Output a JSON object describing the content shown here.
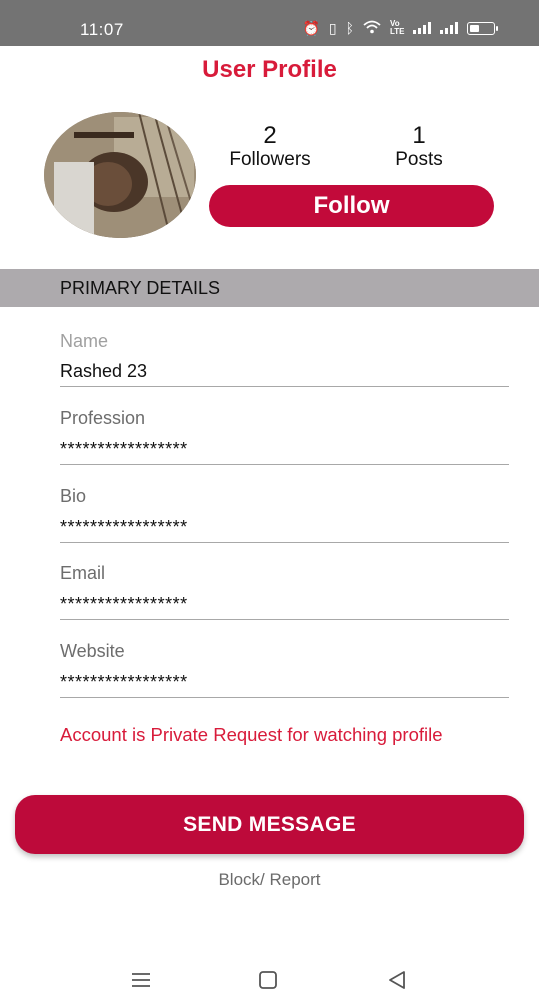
{
  "status_bar": {
    "time": "11:07",
    "icons": [
      "alarm-icon",
      "vibrate-icon",
      "bluetooth-icon",
      "wifi-icon",
      "volte-icon",
      "signal-icon",
      "signal-icon",
      "battery-icon"
    ],
    "volte_text": "Vo LTE"
  },
  "header": {
    "title": "User Profile"
  },
  "profile": {
    "followers_count": "2",
    "followers_label": "Followers",
    "posts_count": "1",
    "posts_label": "Posts",
    "follow_label": "Follow"
  },
  "section": {
    "title": "PRIMARY DETAILS"
  },
  "fields": [
    {
      "label": "Name",
      "value": "Rashed 23"
    },
    {
      "label": "Profession",
      "value": "*****************"
    },
    {
      "label": "Bio",
      "value": "*****************"
    },
    {
      "label": "Email",
      "value": "*****************"
    },
    {
      "label": "Website",
      "value": "*****************"
    }
  ],
  "private_notice": "Account is Private Request for watching profile",
  "send_message_label": "SEND MESSAGE",
  "block_report_label": "Block/ Report",
  "nav": {
    "icons": [
      "menu-icon",
      "home-icon",
      "back-icon"
    ]
  },
  "colors": {
    "accent": "#c20a3a",
    "title_red": "#d81b3a",
    "status_bar": "#737373",
    "section_header": "#adaaad"
  }
}
